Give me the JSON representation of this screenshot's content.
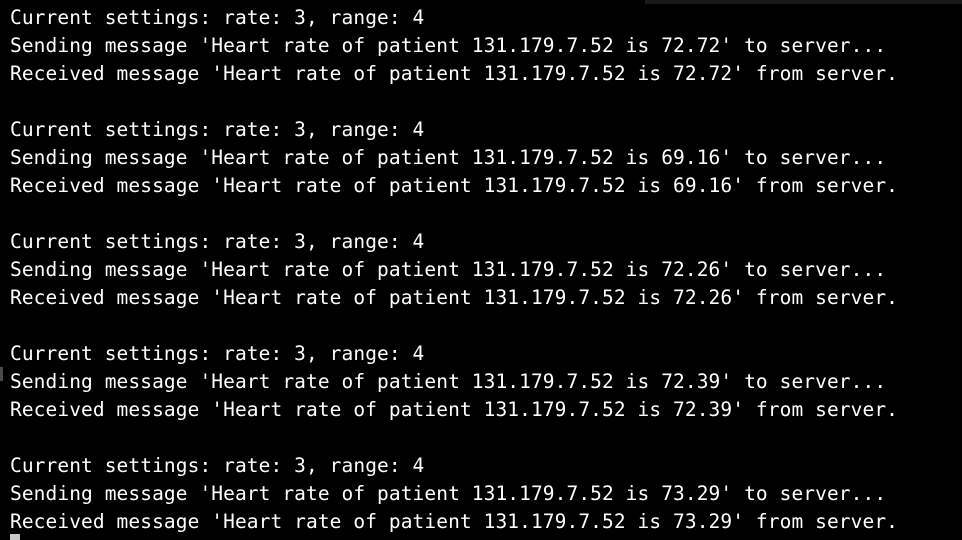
{
  "terminal": {
    "blocks": [
      {
        "settings": "Current settings: rate: 3, range: 4",
        "sending": "Sending message 'Heart rate of patient 131.179.7.52 is 72.72' to server...",
        "received": "Received message 'Heart rate of patient 131.179.7.52 is 72.72' from server."
      },
      {
        "settings": "Current settings: rate: 3, range: 4",
        "sending": "Sending message 'Heart rate of patient 131.179.7.52 is 69.16' to server...",
        "received": "Received message 'Heart rate of patient 131.179.7.52 is 69.16' from server."
      },
      {
        "settings": "Current settings: rate: 3, range: 4",
        "sending": "Sending message 'Heart rate of patient 131.179.7.52 is 72.26' to server...",
        "received": "Received message 'Heart rate of patient 131.179.7.52 is 72.26' from server."
      },
      {
        "settings": "Current settings: rate: 3, range: 4",
        "sending": "Sending message 'Heart rate of patient 131.179.7.52 is 72.39' to server...",
        "received": "Received message 'Heart rate of patient 131.179.7.52 is 72.39' from server."
      },
      {
        "settings": "Current settings: rate: 3, range: 4",
        "sending": "Sending message 'Heart rate of patient 131.179.7.52 is 73.29' to server...",
        "received": "Received message 'Heart rate of patient 131.179.7.52 is 73.29' from server."
      }
    ]
  },
  "colors": {
    "background": "#000000",
    "text": "#ffffff"
  }
}
